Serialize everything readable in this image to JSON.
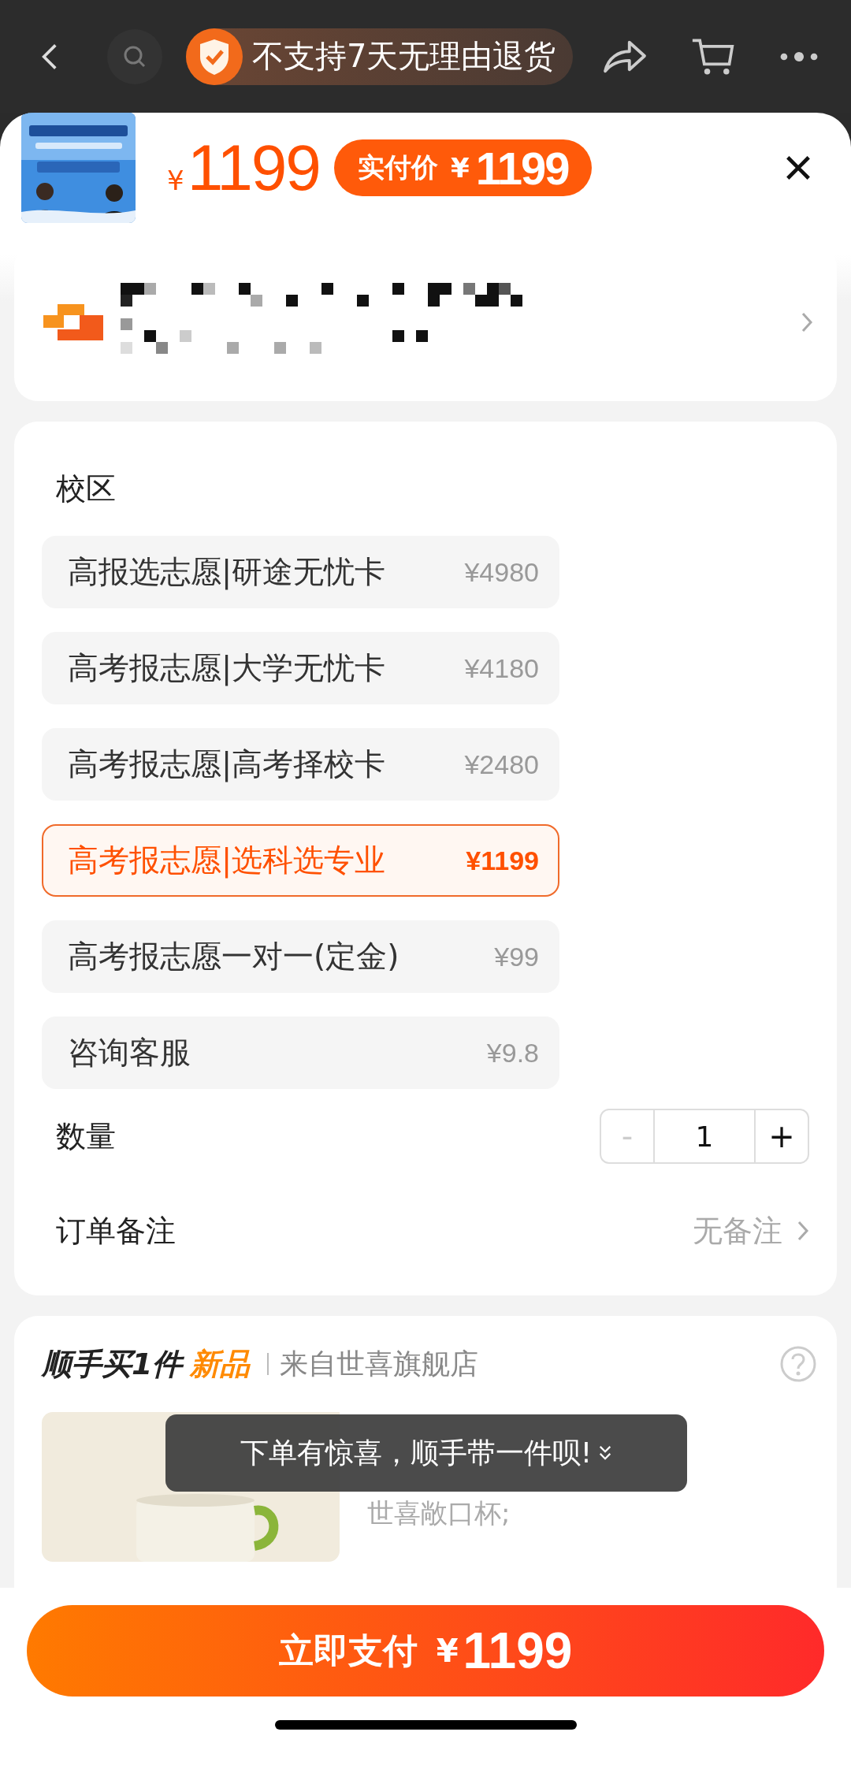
{
  "top_bar": {
    "notice": "不支持7天无理由退货"
  },
  "header": {
    "price_symbol": "¥",
    "price": "1199",
    "paid_label": "实付价",
    "paid_symbol": "¥",
    "paid_price": "1199"
  },
  "options": {
    "title": "校区",
    "items": [
      {
        "label": "高报选志愿|研途无忧卡",
        "price": "¥4980",
        "selected": false
      },
      {
        "label": "高考报志愿|大学无忧卡",
        "price": "¥4180",
        "selected": false
      },
      {
        "label": "高考报志愿|高考择校卡",
        "price": "¥2480",
        "selected": false
      },
      {
        "label": "高考报志愿|选科选专业",
        "price": "¥1199",
        "selected": true
      },
      {
        "label": "高考报志愿一对一(定金)",
        "price": "¥99",
        "selected": false
      },
      {
        "label": "咨询客服",
        "price": "¥9.8",
        "selected": false
      }
    ]
  },
  "quantity": {
    "label": "数量",
    "minus": "-",
    "value": "1",
    "plus": "+",
    "minus_disabled": true
  },
  "remark": {
    "label": "订单备注",
    "value": "无备注"
  },
  "addon": {
    "title": "顺手买1件",
    "tag": "新品",
    "store": "来自世喜旗舰店",
    "product": {
      "subtitle": "世喜敞口杯;"
    },
    "toast": "下单有惊喜，顺手带一件呗!"
  },
  "pay_button": {
    "label": "立即支付",
    "symbol": "¥",
    "amount": "1199"
  }
}
